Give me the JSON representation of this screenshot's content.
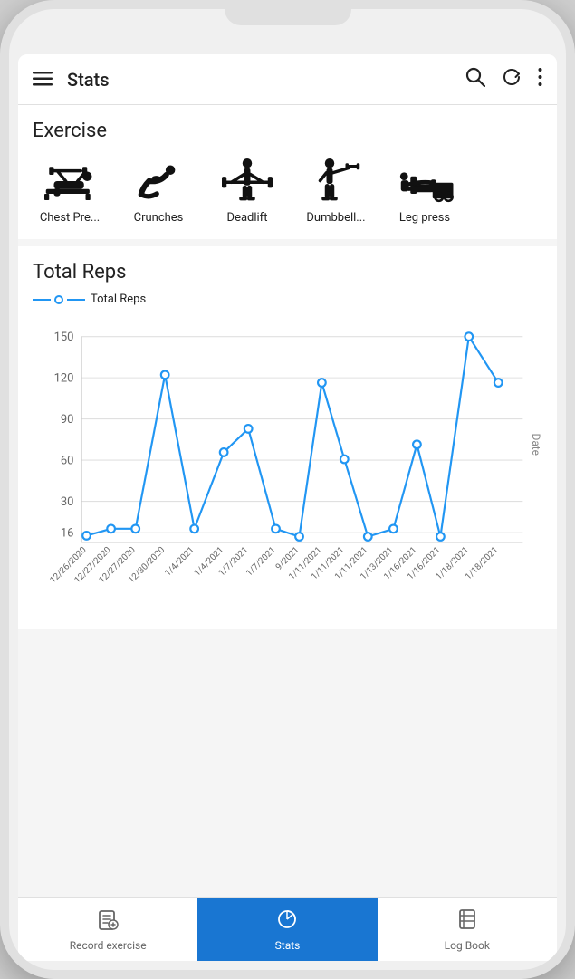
{
  "header": {
    "title": "Stats",
    "menu_icon": "☰",
    "search_icon": "search",
    "refresh_icon": "refresh",
    "more_icon": "more"
  },
  "exercise_section": {
    "title": "Exercise",
    "items": [
      {
        "label": "Chest Pre...",
        "icon": "chest_press"
      },
      {
        "label": "Crunches",
        "icon": "crunches"
      },
      {
        "label": "Deadlift",
        "icon": "deadlift"
      },
      {
        "label": "Dumbbell...",
        "icon": "dumbbell"
      },
      {
        "label": "Leg press",
        "icon": "leg_press"
      }
    ]
  },
  "chart_section": {
    "title": "Total Reps",
    "legend_label": "Total Reps",
    "y_labels": [
      "150",
      "120",
      "90",
      "60",
      "30",
      "16"
    ],
    "x_labels": [
      "12/26/2020",
      "12/27/2020",
      "12/27/2020",
      "12/30/2020",
      "1/4/2021",
      "1/4/2021",
      "1/7/2021",
      "1/7/2021",
      "9/2021",
      "1/11/2021",
      "1/11/2021",
      "1/11/2021",
      "1/13/2021",
      "1/16/2021",
      "1/16/2021",
      "1/18/2021",
      "1/18/2021"
    ],
    "date_axis_label": "Date"
  },
  "bottom_nav": {
    "items": [
      {
        "label": "Record exercise",
        "icon": "edit",
        "active": false
      },
      {
        "label": "Stats",
        "icon": "stats",
        "active": true
      },
      {
        "label": "Log Book",
        "icon": "book",
        "active": false
      }
    ]
  }
}
